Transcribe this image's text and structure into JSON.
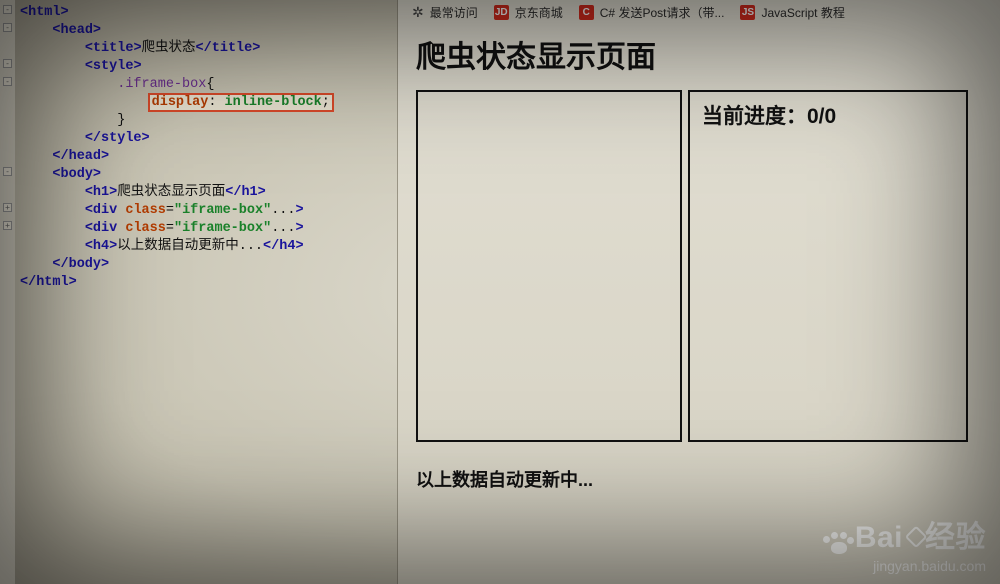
{
  "code": {
    "title_text": "爬虫状态",
    "class_name": "iframe-box",
    "css_prop": "display",
    "css_val": "inline-block",
    "h1_text": "爬虫状态显示页面",
    "div_attr": "class",
    "div_val": "\"iframe-box\"",
    "h4_text": "以上数据自动更新中..."
  },
  "bookmarks": {
    "most_visited": "最常访问",
    "items": [
      {
        "icon": "JD",
        "label": "京东商城"
      },
      {
        "icon": "C",
        "label": "C# 发送Post请求（带..."
      },
      {
        "icon": "JS",
        "label": "JavaScript 教程"
      }
    ]
  },
  "page": {
    "title": "爬虫状态显示页面",
    "progress_label": "当前进度：",
    "progress_value": "0/0",
    "update_text": "以上数据自动更新中..."
  },
  "watermark": {
    "brand_en": "Bai",
    "brand_cn": "经验",
    "url": "jingyan.baidu.com"
  }
}
